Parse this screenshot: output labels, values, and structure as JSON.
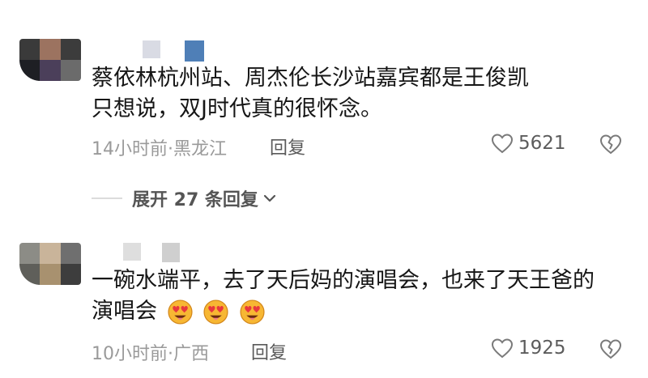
{
  "comments": [
    {
      "text_line1": "蔡依林杭州站、周杰伦长沙站嘉宾都是王俊凯",
      "text_line2": "只想说，双J时代真的很怀念。",
      "time": "14小时前·黑龙江",
      "reply_label": "回复",
      "likes": "5621"
    },
    {
      "text_line1": "一碗水端平，去了天后妈的演唱会，也来了天王爸的",
      "text_line2": "演唱会",
      "emoji_count": 3,
      "time": "10小时前·广西",
      "reply_label": "回复",
      "likes": "1925"
    }
  ],
  "expand_replies": "展开 27 条回复",
  "colors": {
    "text": "#161616",
    "meta": "#9a9a9a",
    "icon": "#7a7a7a"
  }
}
